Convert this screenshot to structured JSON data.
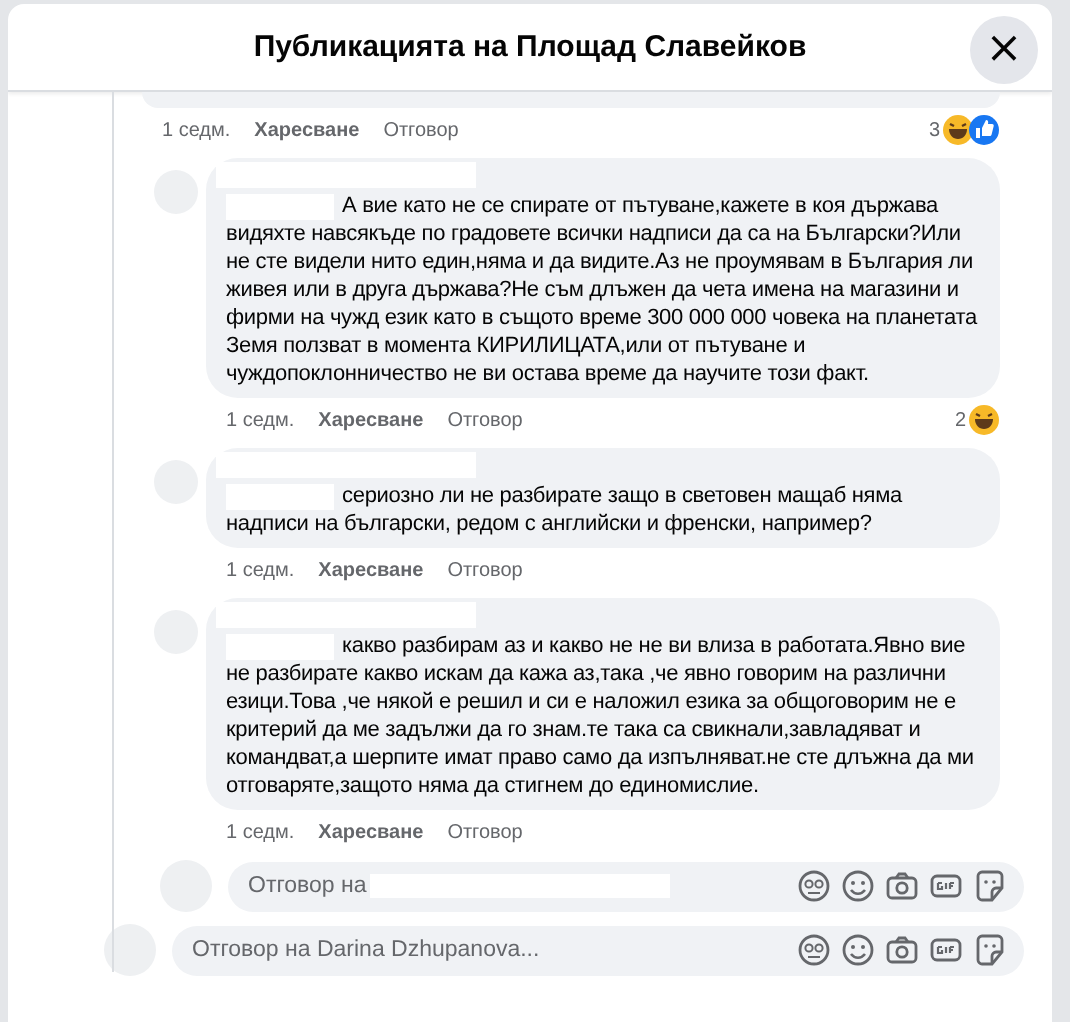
{
  "window": {
    "title": "Публикацията на Площад Славейков",
    "close": "×"
  },
  "comments": [
    {
      "kind": "cut",
      "time": "1 седм.",
      "like": "Харесване",
      "reply": "Отговор",
      "reactions": {
        "count": "3",
        "emoji": [
          {
            "kind": "haha"
          },
          {
            "kind": "like"
          }
        ]
      }
    },
    {
      "kind": "full",
      "name_hidden": true,
      "text": "А вие като не се спирате от пътуване,кажете в коя държава видяхте навсякъде по градовете всички надписи да са на Български?Или не сте видели нито един,няма и да видите.Аз не проумявам в България ли живея или в друга държава?Не съм длъжен да чета имена на магазини и фирми на чужд език като в същото време 300 000 000 човека на планетата Земя ползват в момента КИРИЛИЦАТА,или от пътуване и чуждопоклонничество не ви остава време да научите този факт.",
      "time": "1 седм.",
      "like": "Харесване",
      "reply": "Отговор",
      "reactions": {
        "count": "2",
        "emoji": [
          {
            "kind": "haha"
          }
        ]
      }
    },
    {
      "kind": "full",
      "name_hidden": true,
      "text": "сериозно ли не разбирате защо в световен мащаб няма надписи на български, редом с английски и френски, например?",
      "time": "1 седм.",
      "like": "Харесване",
      "reply": "Отговор"
    },
    {
      "kind": "full",
      "name_hidden": true,
      "text": "какво разбирам аз и какво не не ви влиза в работата.Явно вие не разбирате какво искам да кажа аз,така ,че явно говорим на различни езици.Това ,че някой е решил и си е наложил езика за общоговорим не е критерий да ме задължи да го знам.те така са свикнали,завладяват и командват,а шерпите имат право само да изпълняват.не сте длъжна да ми отговаряте,защото няма да стигнем до единомислие.",
      "time": "1 седм.",
      "like": "Харесване",
      "reply": "Отговор"
    }
  ],
  "reply_fields": [
    {
      "placeholder": "Отговор на",
      "name_hidden": true,
      "kind": "nested"
    },
    {
      "placeholder": "Отговор на Darina Dzhupanova...",
      "name_hidden": false,
      "kind": "top"
    }
  ]
}
